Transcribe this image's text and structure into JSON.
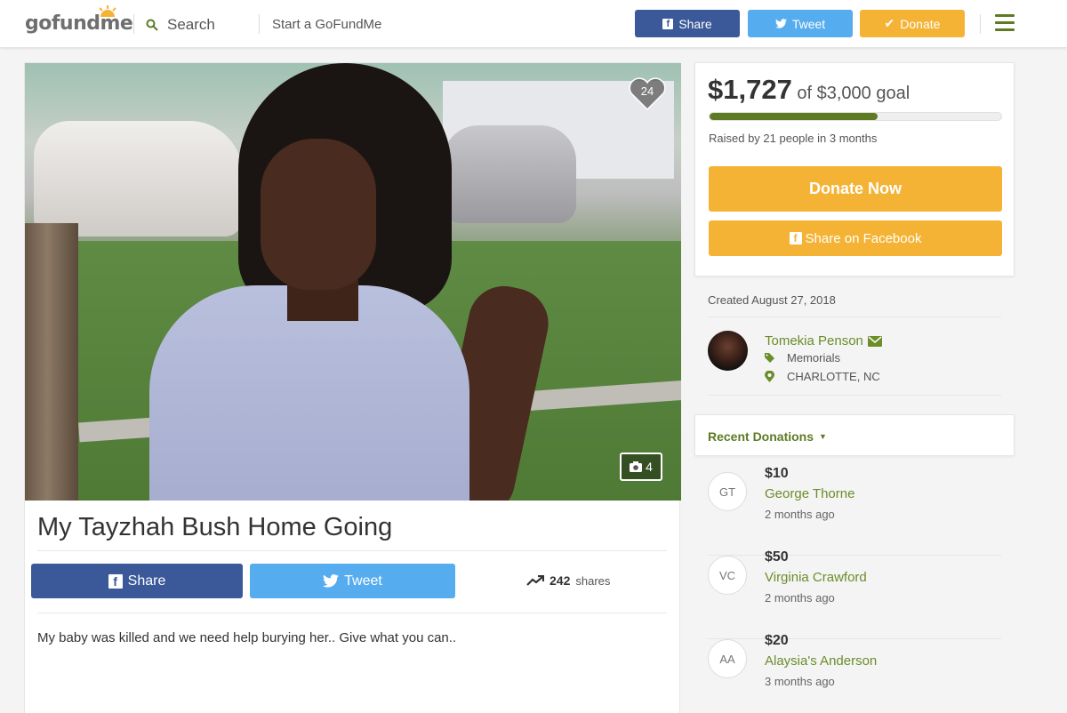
{
  "header": {
    "logo": "gofundme",
    "search_label": "Search",
    "start_label": "Start a GoFundMe",
    "share_label": "Share",
    "tweet_label": "Tweet",
    "donate_label": "Donate"
  },
  "campaign": {
    "hearts": "24",
    "photo_count": "4",
    "title": "My Tayzhah Bush Home Going",
    "share_label": "Share",
    "tweet_label": "Tweet",
    "shares_count": "242",
    "shares_label": "shares",
    "story": "My baby was killed and we need help burying her.. Give what you can.."
  },
  "funding": {
    "raised": "$1,727",
    "goal_text": "of $3,000 goal",
    "progress_fraction": 0.576,
    "raised_by": "Raised by 21 people in 3 months",
    "donate_now_label": "Donate Now",
    "share_facebook_label": "Share on Facebook"
  },
  "organizer": {
    "created": "Created August 27, 2018",
    "name": "Tomekia Penson",
    "category": "Memorials",
    "location": "CHARLOTTE, NC"
  },
  "recent": {
    "label": "Recent Donations",
    "donations": [
      {
        "initials": "GT",
        "amount": "$10",
        "name": "George Thorne",
        "time": "2 months ago"
      },
      {
        "initials": "VC",
        "amount": "$50",
        "name": "Virginia Crawford",
        "time": "2 months ago"
      },
      {
        "initials": "AA",
        "amount": "$20",
        "name": "Alaysia's Anderson",
        "time": "3 months ago"
      }
    ]
  },
  "colors": {
    "brand_green": "#5e7b24",
    "facebook_blue": "#3b5998",
    "twitter_blue": "#55acee",
    "donate_orange": "#f5b335"
  }
}
